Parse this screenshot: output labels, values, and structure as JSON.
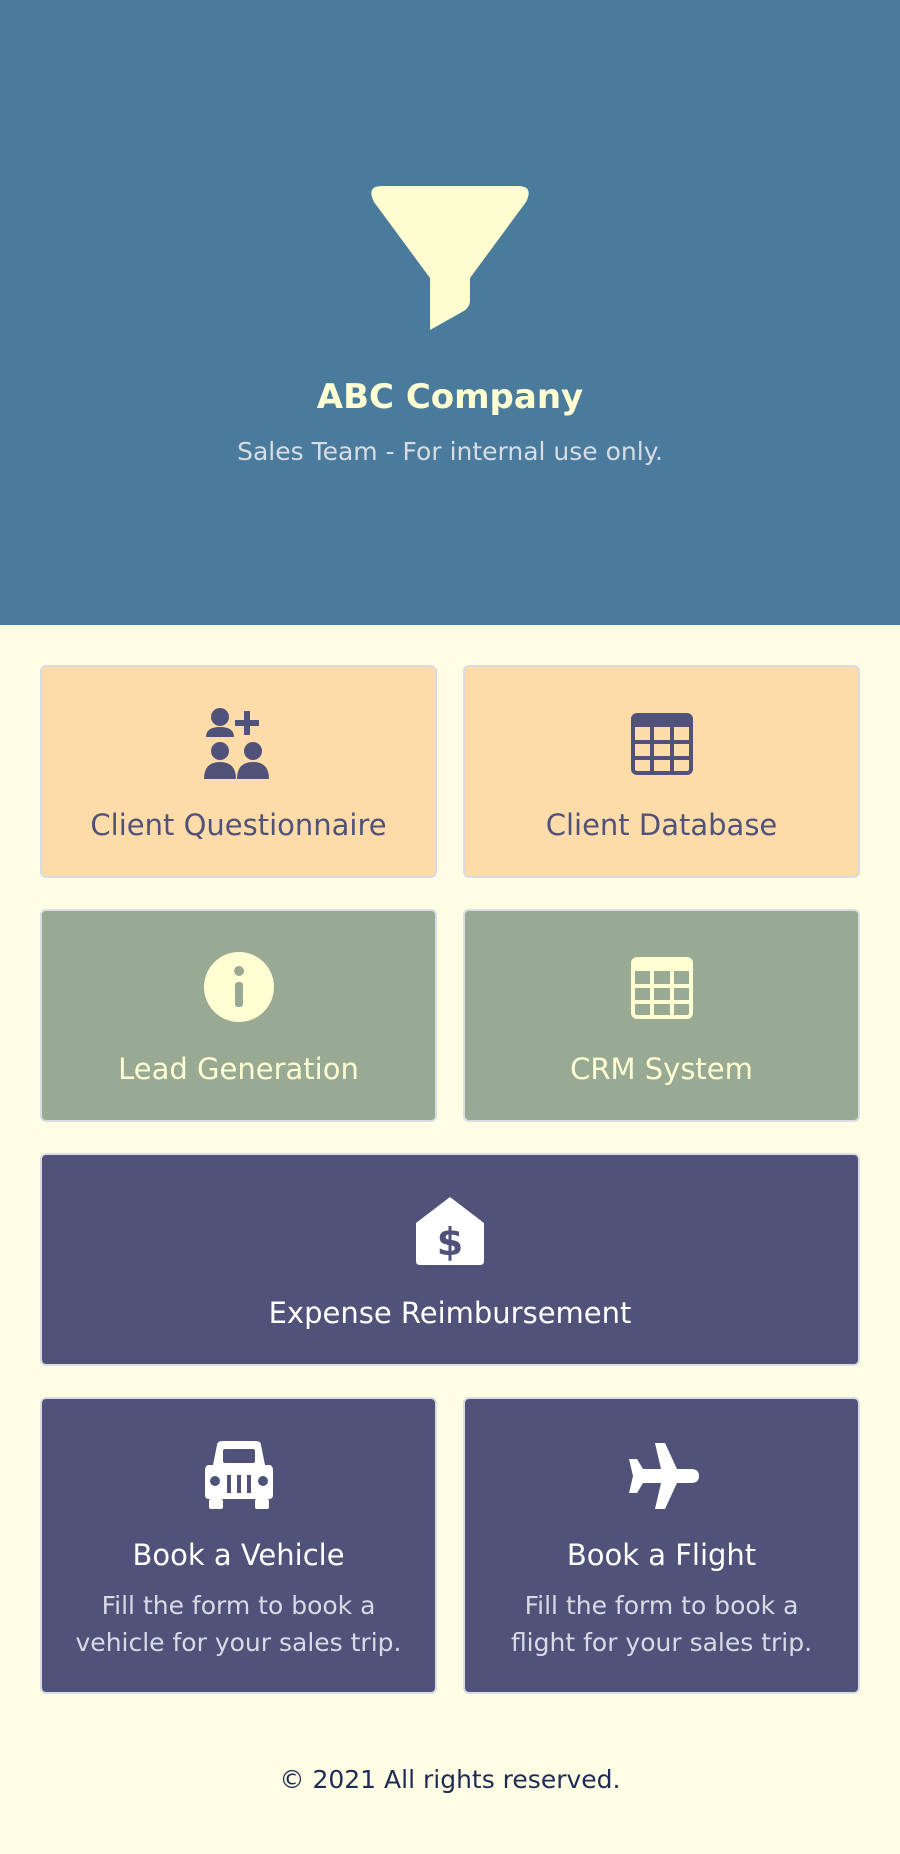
{
  "header": {
    "logo_icon": "funnel-icon",
    "company_name": "ABC Company",
    "tagline": "Sales Team - For internal use only."
  },
  "cards": {
    "client_questionnaire": {
      "title": "Client Questionnaire",
      "icon": "add-users-icon"
    },
    "client_database": {
      "title": "Client Database",
      "icon": "table-grid-icon"
    },
    "lead_generation": {
      "title": "Lead Generation",
      "icon": "info-icon"
    },
    "crm_system": {
      "title": "CRM System",
      "icon": "table-grid-icon"
    },
    "expense_reimbursement": {
      "title": "Expense Reimbursement",
      "icon": "dollar-house-icon"
    },
    "book_vehicle": {
      "title": "Book a Vehicle",
      "description_line1": "Fill the form to book a",
      "description_line2": "vehicle for your sales trip.",
      "icon": "car-icon"
    },
    "book_flight": {
      "title": "Book a Flight",
      "description_line1": "Fill the form to book a",
      "description_line2": "flight for your sales trip.",
      "icon": "airplane-icon"
    }
  },
  "footer": {
    "copyright": "© 2021 All rights reserved."
  },
  "colors": {
    "header_bg": "#4A7A9C",
    "page_bg": "#FEFEE5",
    "peach": "#FDDCAA",
    "sage": "#98A994",
    "indigo": "#51527A",
    "cream": "#FEFED2"
  }
}
